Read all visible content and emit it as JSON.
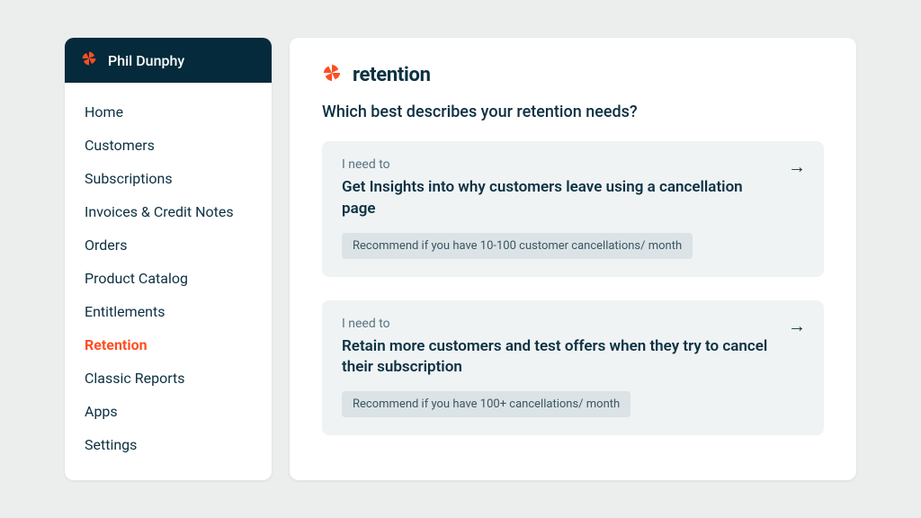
{
  "sidebar": {
    "user_name": "Phil Dunphy",
    "items": [
      {
        "label": "Home"
      },
      {
        "label": "Customers"
      },
      {
        "label": "Subscriptions"
      },
      {
        "label": "Invoices & Credit Notes"
      },
      {
        "label": "Orders"
      },
      {
        "label": "Product Catalog"
      },
      {
        "label": "Entitlements"
      },
      {
        "label": "Retention",
        "active": true
      },
      {
        "label": "Classic Reports"
      },
      {
        "label": "Apps"
      },
      {
        "label": "Settings"
      }
    ]
  },
  "main": {
    "page_title": "retention",
    "question": "Which best describes your retention needs?",
    "cards": [
      {
        "eyebrow": "I need to",
        "title": "Get Insights into why customers leave using a cancellation page",
        "chip": "Recommend if you have 10-100 customer cancellations/ month"
      },
      {
        "eyebrow": "I need to",
        "title": "Retain more customers and test offers when they try to cancel their subscription",
        "chip": "Recommend if you have 100+ cancellations/ month"
      }
    ]
  },
  "colors": {
    "accent": "#ff4e23"
  }
}
